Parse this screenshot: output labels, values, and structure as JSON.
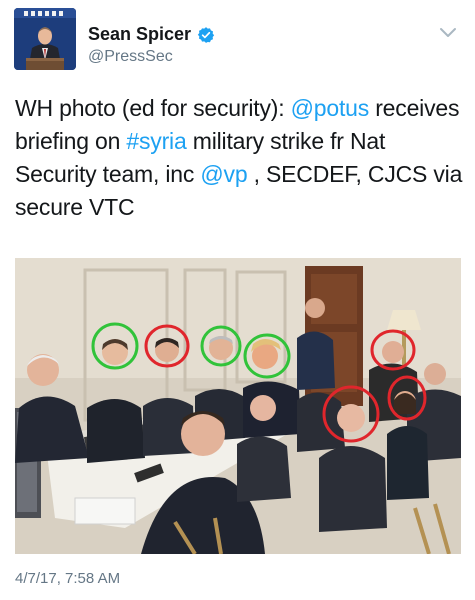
{
  "tweet": {
    "display_name": "Sean Spicer",
    "handle": "@PressSec",
    "verified": true,
    "text": {
      "part1": "WH photo (ed for security): ",
      "mention_potus": "@potus",
      "part2": " receives briefing on ",
      "hashtag_syria": "#syria",
      "part3": " military strike fr Nat Security team, inc ",
      "mention_vp": "@vp",
      "part4": " , SECDEF, CJCS via secure VTC"
    },
    "timestamp": "4/7/17, 7:58 AM"
  },
  "photo": {
    "circles": [
      {
        "color": "green"
      },
      {
        "color": "red"
      },
      {
        "color": "green"
      },
      {
        "color": "green"
      },
      {
        "color": "red"
      },
      {
        "color": "red"
      },
      {
        "color": "red"
      }
    ]
  },
  "colors": {
    "link": "#1da1f2",
    "verified": "#1da1f2",
    "circle_green": "#31c33a",
    "circle_red": "#e0262c",
    "muted": "#657786"
  },
  "icons": {
    "verified": "verified-badge-icon",
    "menu": "chevron-down-icon"
  }
}
